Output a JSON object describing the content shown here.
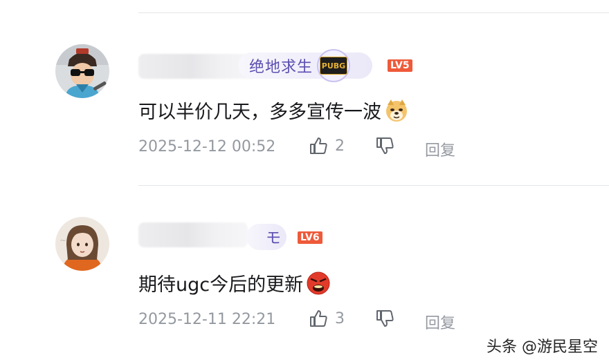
{
  "comments": [
    {
      "medal_text": "绝地求生",
      "medal_badge": "PUBG",
      "level": "LV5",
      "content": "可以半价几天，多多宣传一波",
      "emoji": "doge-emoji",
      "timestamp": "2025-12-12 00:52",
      "likes": "2",
      "reply_label": "回复"
    },
    {
      "medal_text": "モ",
      "level": "LV6",
      "content": "期待ugc今后的更新",
      "emoji": "angry-face-emoji",
      "timestamp": "2025-12-11 22:21",
      "likes": "3",
      "reply_label": "回复"
    }
  ],
  "watermark": "头条 @游民星空",
  "colors": {
    "level_badge": "#ee5a3a",
    "medal_text": "#5b4fb0",
    "meta_text": "#9499a0"
  }
}
